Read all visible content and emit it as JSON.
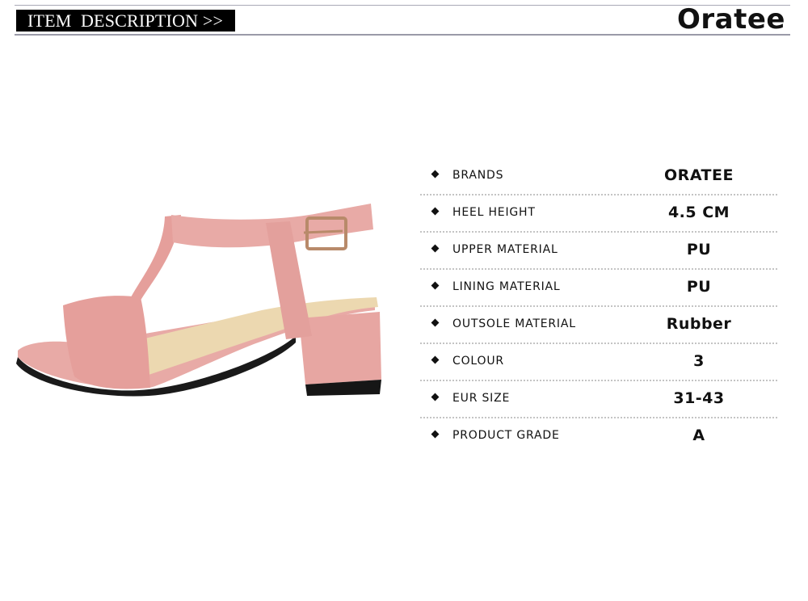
{
  "header": {
    "banner_text": "ITEM  DESCRIPTION >>",
    "brand_logo": "Oratee"
  },
  "product_image": {
    "subject": "pink-suede-t-strap-block-heel-sandal",
    "colors": {
      "suede": "#e8aaa6",
      "sole": "#1a1a1a",
      "insole": "#ecd8b0",
      "buckle": "#b88a6a"
    }
  },
  "specs": [
    {
      "label": "BRANDS",
      "value": "ORATEE"
    },
    {
      "label": "HEEL HEIGHT",
      "value": "4.5 CM"
    },
    {
      "label": "UPPER MATERIAL",
      "value": "PU"
    },
    {
      "label": "LINING MATERIAL",
      "value": "PU"
    },
    {
      "label": "OUTSOLE MATERIAL",
      "value": "Rubber"
    },
    {
      "label": "COLOUR",
      "value": "3"
    },
    {
      "label": "EUR SIZE",
      "value": "31-43"
    },
    {
      "label": "PRODUCT GRADE",
      "value": "A"
    }
  ]
}
